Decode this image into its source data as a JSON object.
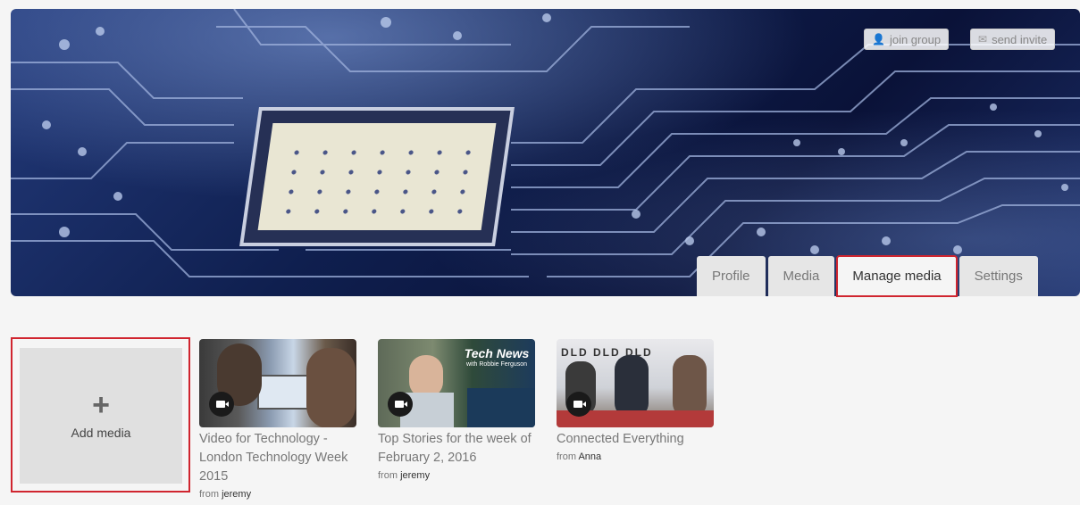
{
  "header": {
    "join_label": "join group",
    "invite_label": "send invite"
  },
  "tabs": [
    {
      "label": "Profile"
    },
    {
      "label": "Media"
    },
    {
      "label": "Manage media"
    },
    {
      "label": "Settings"
    }
  ],
  "add_media_label": "Add media",
  "from_prefix": "from",
  "media": [
    {
      "title": "Video for Technology - London Technology Week 2015",
      "author": "jeremy"
    },
    {
      "title": "Top Stories for the week of February 2, 2016",
      "author": "jeremy",
      "thumb_text": "Tech News",
      "thumb_subtext": "with Robbie Ferguson"
    },
    {
      "title": "Connected Everything",
      "author": "Anna"
    }
  ],
  "colors": {
    "highlight": "#d0252f",
    "banner": "#0f1f4f"
  }
}
